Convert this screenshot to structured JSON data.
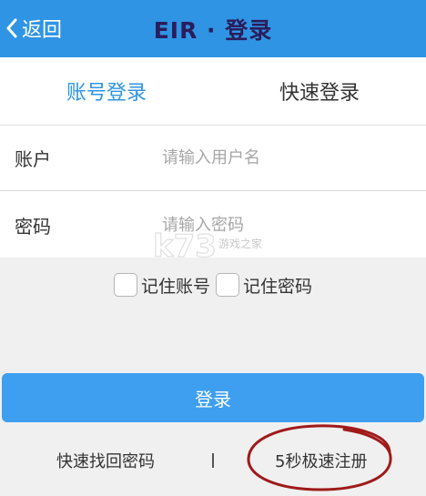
{
  "header": {
    "back_label": "返回",
    "title": "EIR · 登录"
  },
  "tabs": [
    {
      "label": "账号登录",
      "active": true
    },
    {
      "label": "快速登录",
      "active": false
    }
  ],
  "form": {
    "account_label": "账户",
    "account_placeholder": "请输入用户名",
    "password_label": "密码",
    "password_placeholder": "请输入密码"
  },
  "remember": {
    "account_label": "记住账号",
    "password_label": "记住密码"
  },
  "login_label": "登录",
  "links": {
    "forgot_label": "快速找回密码",
    "separator": "I",
    "register_label": "5秒极速注册"
  },
  "watermark": {
    "brand": "k73",
    "tagline": "游戏之家"
  },
  "colors": {
    "header": "#2f94e4",
    "title": "#2a1d5c",
    "accent": "#2f94e4",
    "button": "#3e9ff0",
    "annotation": "#a01a1a"
  }
}
